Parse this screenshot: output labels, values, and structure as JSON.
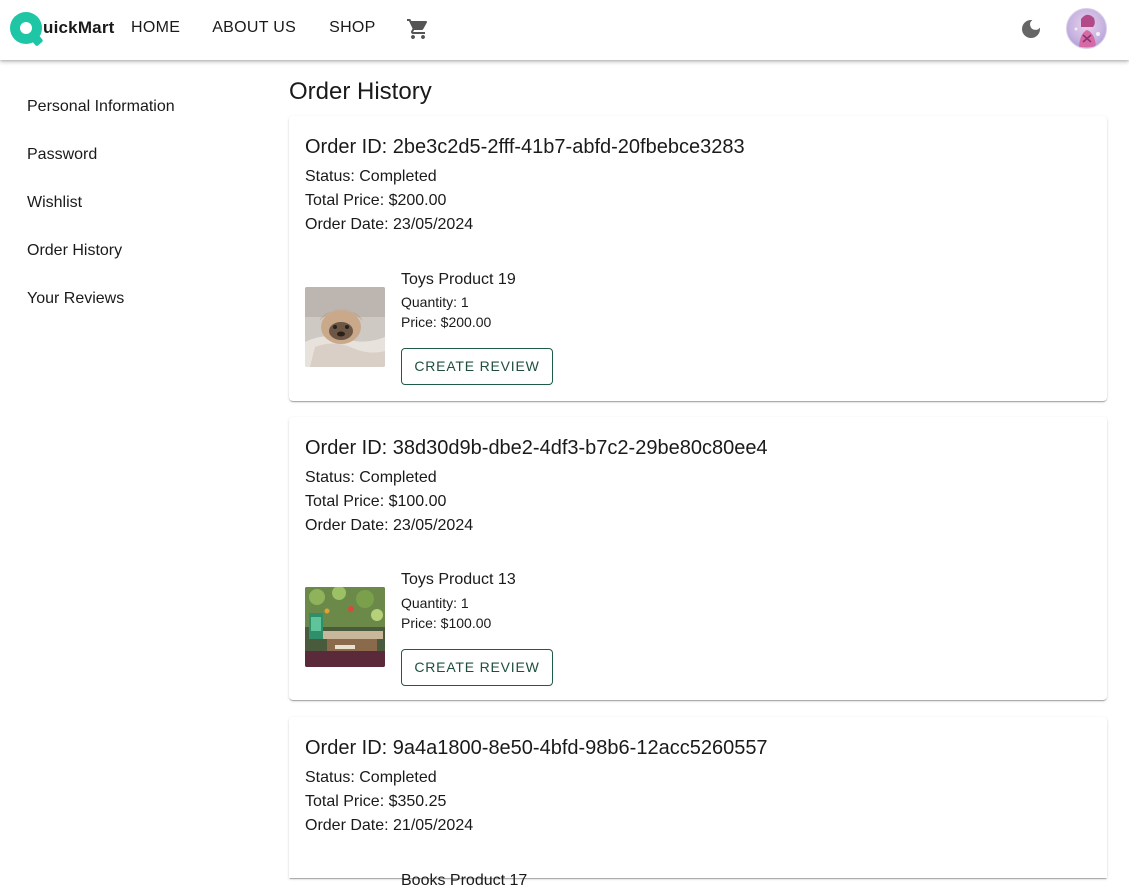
{
  "brand": {
    "logo_text": "uickMart",
    "accent": "#1fc6a6"
  },
  "nav": {
    "home": "HOME",
    "about": "ABOUT US",
    "shop": "SHOP"
  },
  "header_icons": [
    "cart-icon",
    "dark-mode-icon",
    "avatar"
  ],
  "sidebar": {
    "items": [
      {
        "label": "Personal Information"
      },
      {
        "label": "Password"
      },
      {
        "label": "Wishlist"
      },
      {
        "label": "Order History"
      },
      {
        "label": "Your Reviews"
      }
    ]
  },
  "main": {
    "title": "Order History"
  },
  "orders": [
    {
      "id": "Order ID: 2be3c2d5-2fff-41b7-abfd-20fbebce3283",
      "status": "Status: Completed",
      "total": "Total Price: $200.00",
      "date": "Order Date: 23/05/2024",
      "item": {
        "name": "Toys Product 19",
        "quantity": "Quantity: 1",
        "price": "Price: $200.00",
        "button": "CREATE REVIEW"
      }
    },
    {
      "id": "Order ID: 38d30d9b-dbe2-4df3-b7c2-29be80c80ee4",
      "status": "Status: Completed",
      "total": "Total Price: $100.00",
      "date": "Order Date: 23/05/2024",
      "item": {
        "name": "Toys Product 13",
        "quantity": "Quantity: 1",
        "price": "Price: $100.00",
        "button": "CREATE REVIEW"
      }
    },
    {
      "id": "Order ID: 9a4a1800-8e50-4bfd-98b6-12acc5260557",
      "status": "Status: Completed",
      "total": "Total Price: $350.25",
      "date": "Order Date: 21/05/2024",
      "item": {
        "name": "Books Product 17"
      }
    }
  ]
}
